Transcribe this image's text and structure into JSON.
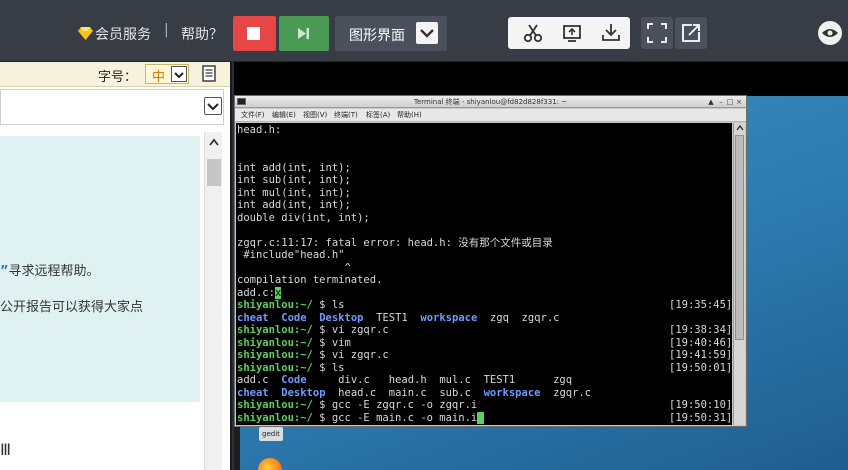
{
  "topbar": {
    "member_service": "会员服务",
    "separator": "|",
    "help": "帮助？",
    "display_mode": "图形界面",
    "tools": [
      "cut-icon",
      "screenshot-icon",
      "download-icon"
    ],
    "fullscreen_icon": "fullscreen-icon",
    "popout_icon": "popout-icon",
    "eye_icon": "eye-icon",
    "colors": {
      "stop": "#e64646",
      "play": "#4a9b55",
      "bar": "#373c45"
    }
  },
  "left_pane": {
    "font_label": "字号：",
    "font_size_value": "中",
    "tip_line1_quote": "”",
    "tip_line1_text": "寻求远程帮助。",
    "tip_line2_text": "公开报告可以获得大家点",
    "bottom_text": "Ⅲ"
  },
  "terminal": {
    "title": "Terminal 终端 - shiyanlou@fd82d828f331: ~",
    "menu": [
      "文件(F)",
      "编辑(E)",
      "视图(V)",
      "终端(T)",
      "标签(A)",
      "帮助(H)"
    ],
    "lines": [
      [
        {
          "t": "head.h:"
        }
      ],
      [
        {
          "t": ""
        }
      ],
      [
        {
          "t": ""
        }
      ],
      [
        {
          "t": "int add(int, int);"
        }
      ],
      [
        {
          "t": "int sub(int, int);"
        }
      ],
      [
        {
          "t": "int mul(int, int);"
        }
      ],
      [
        {
          "t": "int add(int, int);"
        }
      ],
      [
        {
          "t": "double div(int, int);"
        }
      ],
      [
        {
          "t": ""
        }
      ],
      [
        {
          "t": "zgqr.c:11:17: fatal error: head.h: 没有那个文件或目录"
        }
      ],
      [
        {
          "t": " #include\"head.h\""
        }
      ],
      [
        {
          "t": "                 ^"
        }
      ],
      [
        {
          "t": "compilation terminated."
        }
      ],
      [
        {
          "t": "add.c:"
        },
        {
          "t": "x",
          "c": "cursor"
        }
      ],
      [
        {
          "t": "shiyanlou:~/",
          "c": "prompt"
        },
        {
          "t": " $ ls"
        }
      ],
      [
        {
          "t": "cheat",
          "c": "blue"
        },
        {
          "t": "  "
        },
        {
          "t": "Code",
          "c": "blue"
        },
        {
          "t": "  "
        },
        {
          "t": "Desktop",
          "c": "blue"
        },
        {
          "t": "  TEST1  "
        },
        {
          "t": "workspace",
          "c": "blue"
        },
        {
          "t": "  zgq  zgqr.c"
        }
      ],
      [
        {
          "t": "shiyanlou:~/",
          "c": "prompt"
        },
        {
          "t": " $ vi zgqr.c"
        }
      ],
      [
        {
          "t": "shiyanlou:~/",
          "c": "prompt"
        },
        {
          "t": " $ vim"
        }
      ],
      [
        {
          "t": "shiyanlou:~/",
          "c": "prompt"
        },
        {
          "t": " $ vi zgqr.c"
        }
      ],
      [
        {
          "t": "shiyanlou:~/",
          "c": "prompt"
        },
        {
          "t": " $ ls"
        }
      ],
      [
        {
          "t": "add.c  "
        },
        {
          "t": "Code",
          "c": "blue"
        },
        {
          "t": "     div.c   head.h  mul.c  TEST1      zgq"
        }
      ],
      [
        {
          "t": "cheat",
          "c": "blue"
        },
        {
          "t": "  "
        },
        {
          "t": "Desktop",
          "c": "blue"
        },
        {
          "t": "  head.c  main.c  sub.c  "
        },
        {
          "t": "workspace",
          "c": "blue"
        },
        {
          "t": "  zgqr.c"
        }
      ],
      [
        {
          "t": "shiyanlou:~/",
          "c": "prompt"
        },
        {
          "t": " $ gcc -E zgqr.c -o zgqr.i"
        }
      ],
      [
        {
          "t": "shiyanlou:~/",
          "c": "prompt"
        },
        {
          "t": " $ gcc -E main.c -o main.i"
        },
        {
          "t": " ",
          "c": "cursor"
        }
      ]
    ],
    "timestamps": {
      "14": "[19:35:45]",
      "16": "[19:38:34]",
      "17": "[19:40:46]",
      "18": "[19:41:59]",
      "19": "[19:50:01]",
      "22": "[19:50:10]",
      "23": "[19:50:31]"
    }
  },
  "desktop": {
    "icon_label": "gedit",
    "bottom_icon": "firefox-icon"
  }
}
